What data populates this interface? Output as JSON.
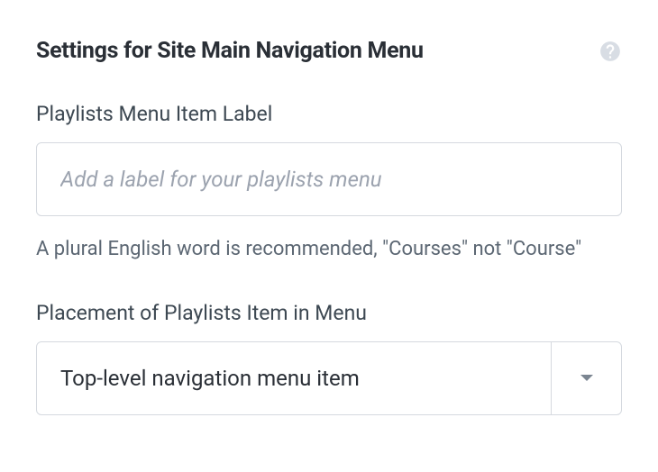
{
  "header": {
    "title": "Settings for Site Main Navigation Menu"
  },
  "fields": {
    "menuLabel": {
      "label": "Playlists Menu Item Label",
      "placeholder": "Add a label for your playlists menu",
      "helpText": "A plural English word is recommended, \"Courses\" not \"Course\""
    },
    "placement": {
      "label": "Placement of Playlists Item in Menu",
      "selected": "Top-level navigation menu item"
    }
  }
}
